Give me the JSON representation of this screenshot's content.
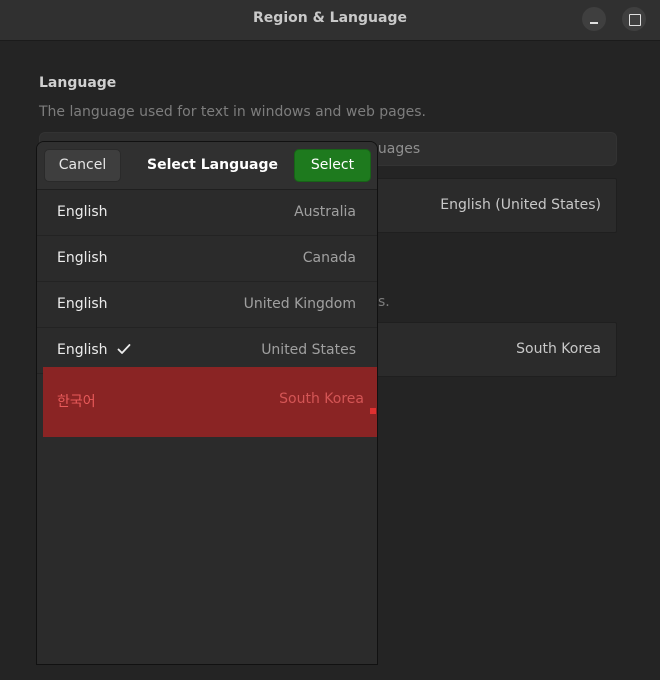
{
  "window": {
    "title": "Region & Language",
    "minimize_icon": "minimize-icon",
    "maximize_icon": "maximize-icon"
  },
  "background": {
    "section_title": "Language",
    "section_desc": "The language used for text in windows and web pages.",
    "search_text_fragment": "guages",
    "row1_value": "English (United States)",
    "desc2_fragment": "s.",
    "row2_value": "South Korea"
  },
  "dialog": {
    "cancel_label": "Cancel",
    "title": "Select Language",
    "select_label": "Select",
    "languages": [
      {
        "name": "English",
        "region": "Australia",
        "checked": false
      },
      {
        "name": "English",
        "region": "Canada",
        "checked": false
      },
      {
        "name": "English",
        "region": "United Kingdom",
        "checked": false
      },
      {
        "name": "English",
        "region": "United States",
        "checked": true
      }
    ],
    "highlighted": {
      "name": "한국어",
      "region": "South Korea"
    }
  },
  "colors": {
    "background": "#242424",
    "accent_green": "#1e7a1e",
    "highlight_red": "#8a2424"
  }
}
